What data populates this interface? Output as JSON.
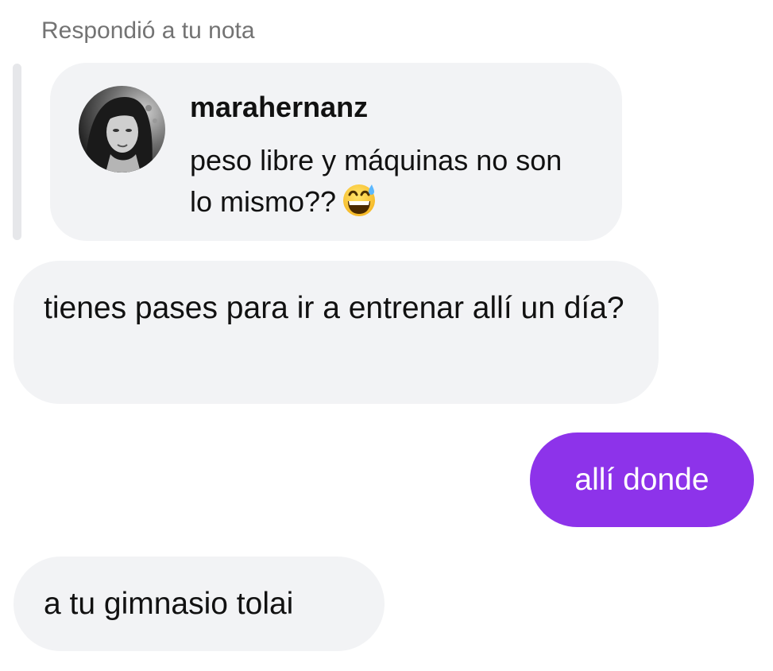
{
  "reply_label": "Respondió a tu nota",
  "note": {
    "username": "marahernanz",
    "text": "peso libre y máquinas no son lo mismo??",
    "emoji": "grinning-face-with-sweat"
  },
  "messages": [
    {
      "direction": "incoming",
      "text": "tienes pases para ir a entrenar allí un día?"
    },
    {
      "direction": "outgoing",
      "text": "allí donde"
    },
    {
      "direction": "incoming",
      "text": "a tu gimnasio tolai"
    }
  ],
  "colors": {
    "incoming_bubble": "#f2f3f5",
    "outgoing_bubble": "#8d33ea",
    "reply_label": "#737373",
    "reply_bar": "#e6e7ea"
  }
}
